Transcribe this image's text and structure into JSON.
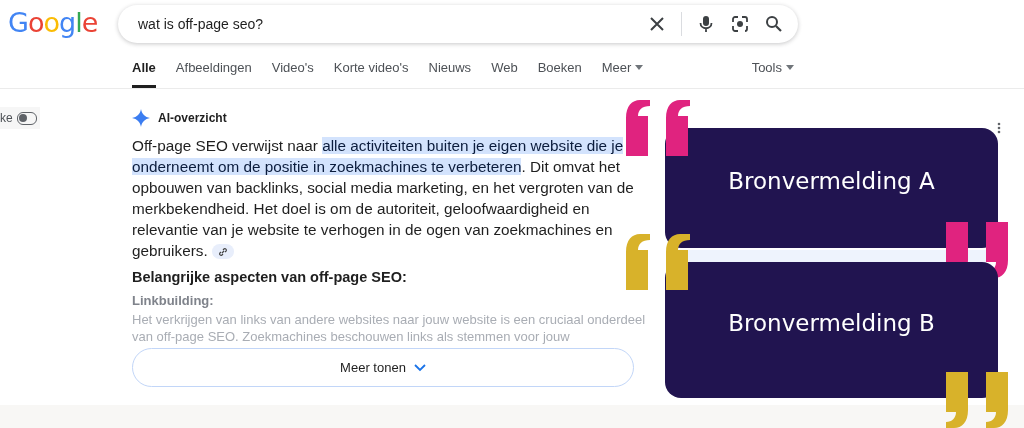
{
  "logo": "Google",
  "search": {
    "value": "wat is off-page seo?"
  },
  "tabs": [
    {
      "label": "Alle",
      "selected": true,
      "menu": false
    },
    {
      "label": "Afbeeldingen",
      "selected": false,
      "menu": false
    },
    {
      "label": "Video's",
      "selected": false,
      "menu": false
    },
    {
      "label": "Korte video's",
      "selected": false,
      "menu": false
    },
    {
      "label": "Nieuws",
      "selected": false,
      "menu": false
    },
    {
      "label": "Web",
      "selected": false,
      "menu": false
    },
    {
      "label": "Boeken",
      "selected": false,
      "menu": false
    },
    {
      "label": "Meer",
      "selected": false,
      "menu": true
    }
  ],
  "tools": "Tools",
  "side_toggle": {
    "label": "ke",
    "on": false
  },
  "ai_overview": {
    "title": "AI-overzicht",
    "summary": "Off-page SEO verwijst naar **alle activiteiten buiten je eigen website die je onderneemt om de positie in zoekmachines te verbeteren**. Dit omvat het opbouwen van backlinks, social media marketing, en het vergroten van de merkbekendheid. Het doel is om de autoriteit, geloofwaardigheid en relevantie van je website te verhogen in de ogen van zoekmachines en gebruikers.",
    "heading": "Belangrijke aspecten van off-page SEO:",
    "subheading": "Linkbuilding:",
    "faded_text": "Het verkrijgen van links van andere websites naar jouw website is een cruciaal onderdeel van off-page SEO. Zoekmachines beschouwen links als stemmen voor jouw",
    "more_button": "Meer tonen"
  },
  "citations": [
    {
      "label": "Bronvermelding A",
      "color": "#e0237f"
    },
    {
      "label": "Bronvermelding B",
      "color": "#d8b22a"
    }
  ]
}
